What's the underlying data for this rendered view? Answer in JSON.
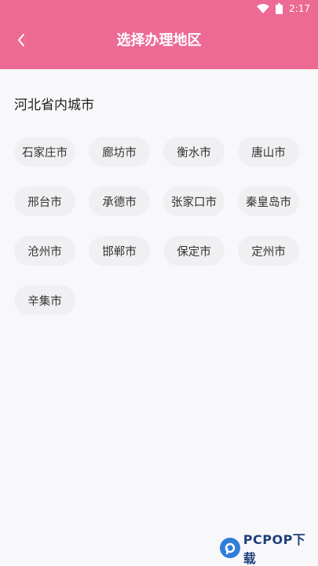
{
  "status_bar": {
    "time": "2:17",
    "icons": [
      "wifi-icon",
      "battery-icon"
    ]
  },
  "header": {
    "title": "选择办理地区",
    "back_icon": "chevron-left-icon",
    "background": "#ec6a93"
  },
  "section": {
    "title": "河北省内城市",
    "cities": [
      "石家庄市",
      "廊坊市",
      "衡水市",
      "唐山市",
      "邢台市",
      "承德市",
      "张家口市",
      "秦皇岛市",
      "沧州市",
      "邯郸市",
      "保定市",
      "定州市",
      "辛集市"
    ]
  },
  "watermark": {
    "text": "PCPOP下载"
  }
}
